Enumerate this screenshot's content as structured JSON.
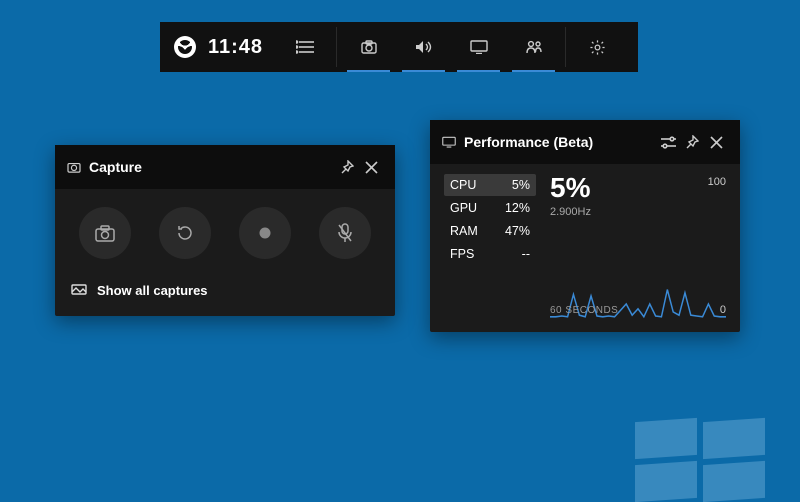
{
  "toolbar": {
    "time": "11:48"
  },
  "capture": {
    "title": "Capture",
    "show_all": "Show all captures"
  },
  "perf": {
    "title": "Performance (Beta)",
    "metrics": {
      "cpu_label": "CPU",
      "cpu_val": "5%",
      "gpu_label": "GPU",
      "gpu_val": "12%",
      "ram_label": "RAM",
      "ram_val": "47%",
      "fps_label": "FPS",
      "fps_val": "--"
    },
    "big_percent": "5%",
    "frequency": "2.900Hz",
    "y_max": "100",
    "y_min": "0",
    "x_label": "60 SECONDS"
  },
  "chart_data": {
    "type": "line",
    "title": "CPU usage",
    "xlabel": "60 SECONDS",
    "ylabel": "",
    "ylim": [
      0,
      100
    ],
    "x": [
      0,
      2,
      4,
      6,
      8,
      10,
      12,
      14,
      16,
      18,
      20,
      22,
      24,
      26,
      28,
      30,
      32,
      34,
      36,
      38,
      40,
      42,
      44,
      46,
      48,
      50,
      52,
      54,
      56,
      58,
      60
    ],
    "values": [
      4,
      4,
      5,
      4,
      32,
      6,
      4,
      30,
      5,
      4,
      5,
      4,
      12,
      20,
      6,
      14,
      4,
      20,
      5,
      4,
      38,
      10,
      6,
      34,
      6,
      5,
      4,
      20,
      5,
      4,
      4
    ]
  }
}
